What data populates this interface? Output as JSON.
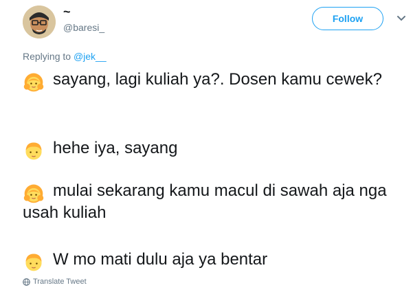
{
  "user": {
    "display_name": "~",
    "handle": "@baresi_"
  },
  "actions": {
    "follow_label": "Follow"
  },
  "reply": {
    "prefix": "Replying to ",
    "mention": "@jek__"
  },
  "lines": [
    {
      "speaker_icon": "girl-emoji-icon",
      "text": "sayang, lagi kuliah ya?. Dosen kamu cewek?"
    },
    {
      "speaker_icon": "boy-emoji-icon",
      "text": "hehe iya, sayang"
    },
    {
      "speaker_icon": "girl-emoji-icon",
      "text": "mulai sekarang kamu macul di sawah aja nga usah kuliah"
    },
    {
      "speaker_icon": "boy-emoji-icon",
      "text": "W mo mati dulu aja ya bentar"
    }
  ],
  "translate": {
    "label": "Translate Tweet"
  },
  "colors": {
    "accent": "#1da1f2",
    "muted": "#657786",
    "text": "#14171a"
  }
}
